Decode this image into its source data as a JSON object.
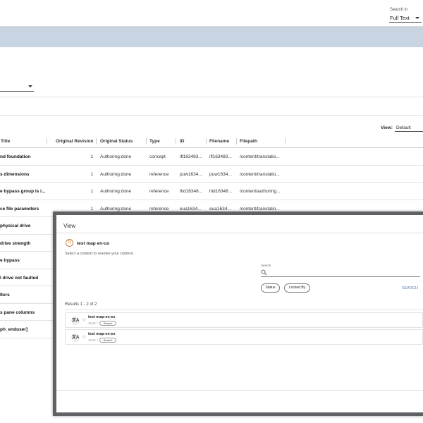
{
  "header": {
    "search_in_label": "Search in",
    "search_in_value": "Full Text"
  },
  "view": {
    "label": "View:",
    "value": "Default"
  },
  "table": {
    "columns": [
      "Title",
      "Original Revision",
      "Original Status",
      "Type",
      "ID",
      "Filename",
      "Filepath"
    ],
    "rows": [
      {
        "title": "nd foundation",
        "rev": "1",
        "status": "Authoring:done",
        "type": "concept",
        "id": "ifl163483...",
        "filename": "ifl163483...",
        "filepath": "/content/translatio..."
      },
      {
        "title": "s dimensions",
        "rev": "1",
        "status": "Authoring:done",
        "type": "reference",
        "id": "puw1634...",
        "filename": "puw1634...",
        "filepath": "/content/translatio..."
      },
      {
        "title": "e bypass group is i...",
        "rev": "1",
        "status": "Authoring:done",
        "type": "reference",
        "id": "lhd16348...",
        "filename": "lhd16348...",
        "filepath": "/content/authoring..."
      },
      {
        "title": "ce file parameters",
        "rev": "1",
        "status": "Authoring:done",
        "type": "reference",
        "id": "eua1634...",
        "filename": "eua1634...",
        "filepath": "/content/translatio..."
      },
      {
        "title": "physical drive"
      },
      {
        "title": "drive strength"
      },
      {
        "title": "e bypass"
      },
      {
        "title": "l drive not faulted"
      },
      {
        "title": "lters"
      },
      {
        "title": "s pane columns"
      },
      {
        "title": "ph_enduser]"
      }
    ]
  },
  "dialog": {
    "title": "View",
    "map_name": "test map en-us",
    "instruction": "Select a context to resolve your content.",
    "search_label": "Search",
    "filter_status": "Status",
    "filter_locked_by": "Locked By",
    "search_button": "SEARCH",
    "results_summary": "Results 1 - 2 of 2",
    "results": [
      {
        "title": "test map-es-es",
        "sub": "11111 /",
        "chip": "Search"
      },
      {
        "title": "test map-es-es",
        "sub": "11111 /",
        "chip": "Search"
      }
    ]
  },
  "icons": {
    "map": "map-icon",
    "language": "translate-icon",
    "star": "star-icon",
    "search": "search-icon"
  }
}
